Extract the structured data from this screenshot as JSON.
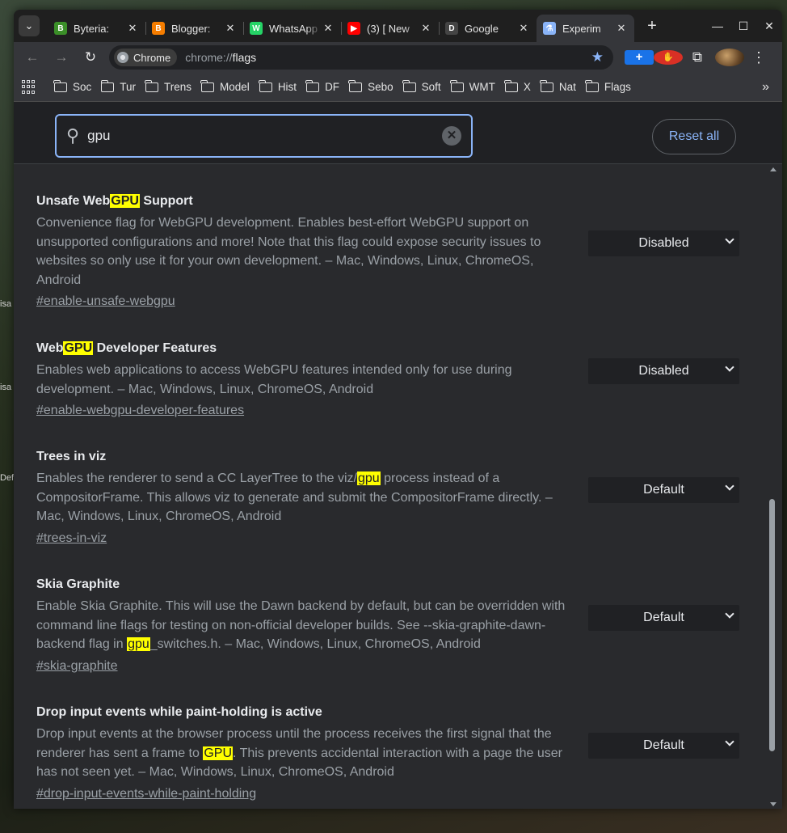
{
  "tabs": [
    {
      "title": "Byteria:",
      "favicon": "byteria-icon",
      "color": "#3b8f28",
      "glyph": "B"
    },
    {
      "title": "Blogger:",
      "favicon": "blogger-icon",
      "color": "#f57d00",
      "glyph": "B"
    },
    {
      "title": "WhatsApp",
      "favicon": "whatsapp-icon",
      "color": "#25d366",
      "glyph": "W"
    },
    {
      "title": "(3) [ New",
      "favicon": "youtube-icon",
      "color": "#ff0000",
      "glyph": "▶"
    },
    {
      "title": "Google",
      "favicon": "google-icon",
      "color": "#444444",
      "glyph": "D"
    },
    {
      "title": "Experim",
      "favicon": "flask-icon",
      "color": "#8ab4f8",
      "glyph": "⚗",
      "active": true
    }
  ],
  "toolbar": {
    "chip_label": "Chrome",
    "url_scheme": "chrome://",
    "url_path": "flags"
  },
  "bookmarks": [
    "Soc",
    "Tur",
    "Trens",
    "Model",
    "Hist",
    "DF",
    "Sebo",
    "Soft",
    "WMT",
    "X",
    "Nat",
    "Flags"
  ],
  "search": {
    "value": "gpu"
  },
  "reset_label": "Reset all",
  "flags": [
    {
      "title_pre": "Unsafe Web",
      "title_mark": "GPU",
      "title_post": " Support",
      "desc_pre": "Convenience flag for WebGPU development. Enables best-effort WebGPU support on unsupported configurations and more! Note that this flag could expose security issues to websites so only use it for your own development. – Mac, Windows, Linux, ChromeOS, Android",
      "desc_mark": "",
      "desc_post": "",
      "link": "#enable-unsafe-webgpu",
      "value": "Disabled"
    },
    {
      "title_pre": "Web",
      "title_mark": "GPU",
      "title_post": " Developer Features",
      "desc_pre": "Enables web applications to access WebGPU features intended only for use during development. – Mac, Windows, Linux, ChromeOS, Android",
      "desc_mark": "",
      "desc_post": "",
      "link": "#enable-webgpu-developer-features",
      "value": "Disabled"
    },
    {
      "title_pre": "Trees in viz",
      "title_mark": "",
      "title_post": "",
      "desc_pre": "Enables the renderer to send a CC LayerTree to the viz/",
      "desc_mark": "gpu",
      "desc_post": " process instead of a CompositorFrame. This allows viz to generate and submit the CompositorFrame directly. – Mac, Windows, Linux, ChromeOS, Android",
      "link": "#trees-in-viz",
      "value": "Default"
    },
    {
      "title_pre": "Skia Graphite",
      "title_mark": "",
      "title_post": "",
      "desc_pre": "Enable Skia Graphite. This will use the Dawn backend by default, but can be overridden with command line flags for testing on non-official developer builds. See --skia-graphite-dawn-backend flag in ",
      "desc_mark": "gpu",
      "desc_post": "_switches.h. – Mac, Windows, Linux, ChromeOS, Android",
      "link": "#skia-graphite",
      "value": "Default"
    },
    {
      "title_pre": "Drop input events while paint-holding is active",
      "title_mark": "",
      "title_post": "",
      "desc_pre": "Drop input events at the browser process until the process receives the first signal that the renderer has sent a frame to ",
      "desc_mark": "GPU",
      "desc_post": ". This prevents accidental interaction with a page the user has not seen yet. – Mac, Windows, Linux, ChromeOS, Android",
      "link": "#drop-input-events-while-paint-holding",
      "value": "Default"
    }
  ],
  "desktop_peeks": [
    "isa",
    "isa",
    "Defa"
  ]
}
